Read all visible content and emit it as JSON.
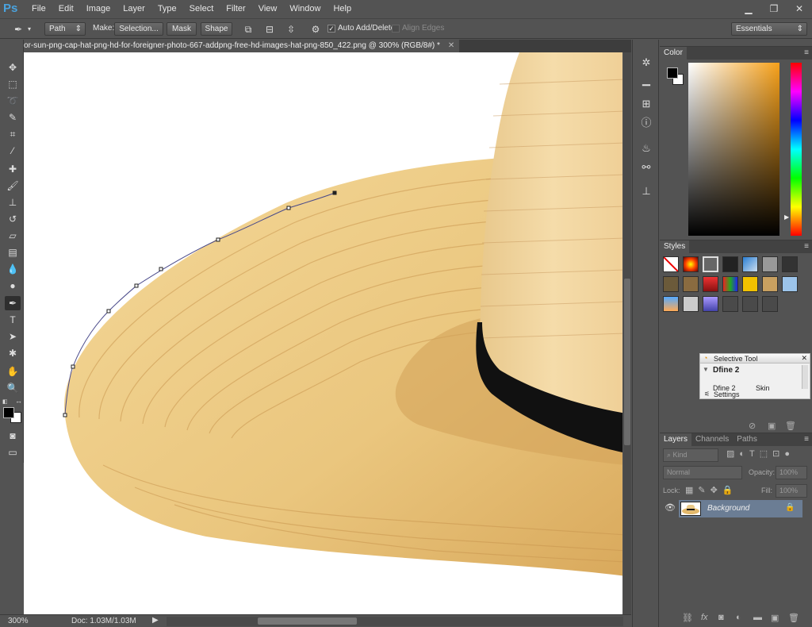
{
  "app": {
    "logo": "Ps"
  },
  "menus": [
    "File",
    "Edit",
    "Image",
    "Layer",
    "Type",
    "Select",
    "Filter",
    "View",
    "Window",
    "Help"
  ],
  "window_controls": {
    "minimize": "▁",
    "restore": "❐",
    "close": "✕"
  },
  "options": {
    "mode_select": "Path",
    "make_label": "Make:",
    "selection_btn": "Selection...",
    "mask_btn": "Mask",
    "shape_btn": "Shape",
    "auto_add_delete": "Auto Add/Delete",
    "auto_add_checked": "✓",
    "align_edges": "Align Edges",
    "workspace": "Essentials"
  },
  "document": {
    "tab_title": "or-sun-png-cap-hat-png-hd-for-foreigner-photo-667-addpng-free-hd-images-hat-png-850_422.png @ 300% (RGB/8#) *",
    "close": "✕"
  },
  "status": {
    "zoom": "300%",
    "doc_info": "Doc: 1.03M/1.03M",
    "arrow": "▶"
  },
  "panels": {
    "color": {
      "tab": "Color"
    },
    "styles": {
      "tab": "Styles"
    },
    "selective": {
      "title": "Selective Tool",
      "section": "Dfine 2",
      "col1": "Dfine 2",
      "col2": "Skin",
      "settings": "Settings"
    },
    "layers": {
      "tabs": [
        "Layers",
        "Channels",
        "Paths"
      ],
      "kind": "Kind",
      "blend": "Normal",
      "opacity_label": "Opacity:",
      "opacity_value": "100%",
      "lock_label": "Lock:",
      "fill_label": "Fill:",
      "fill_value": "100%",
      "layer_name": "Background"
    }
  },
  "colors": {
    "ui_bg": "#535353",
    "accent": "#4aa3df",
    "fg_color": "#000000",
    "bg_color": "#ffffff",
    "hat_light": "#f2d28c",
    "hat_mid": "#e0b66a",
    "hat_band": "#111111",
    "layer_selected": "#6b7d94"
  }
}
